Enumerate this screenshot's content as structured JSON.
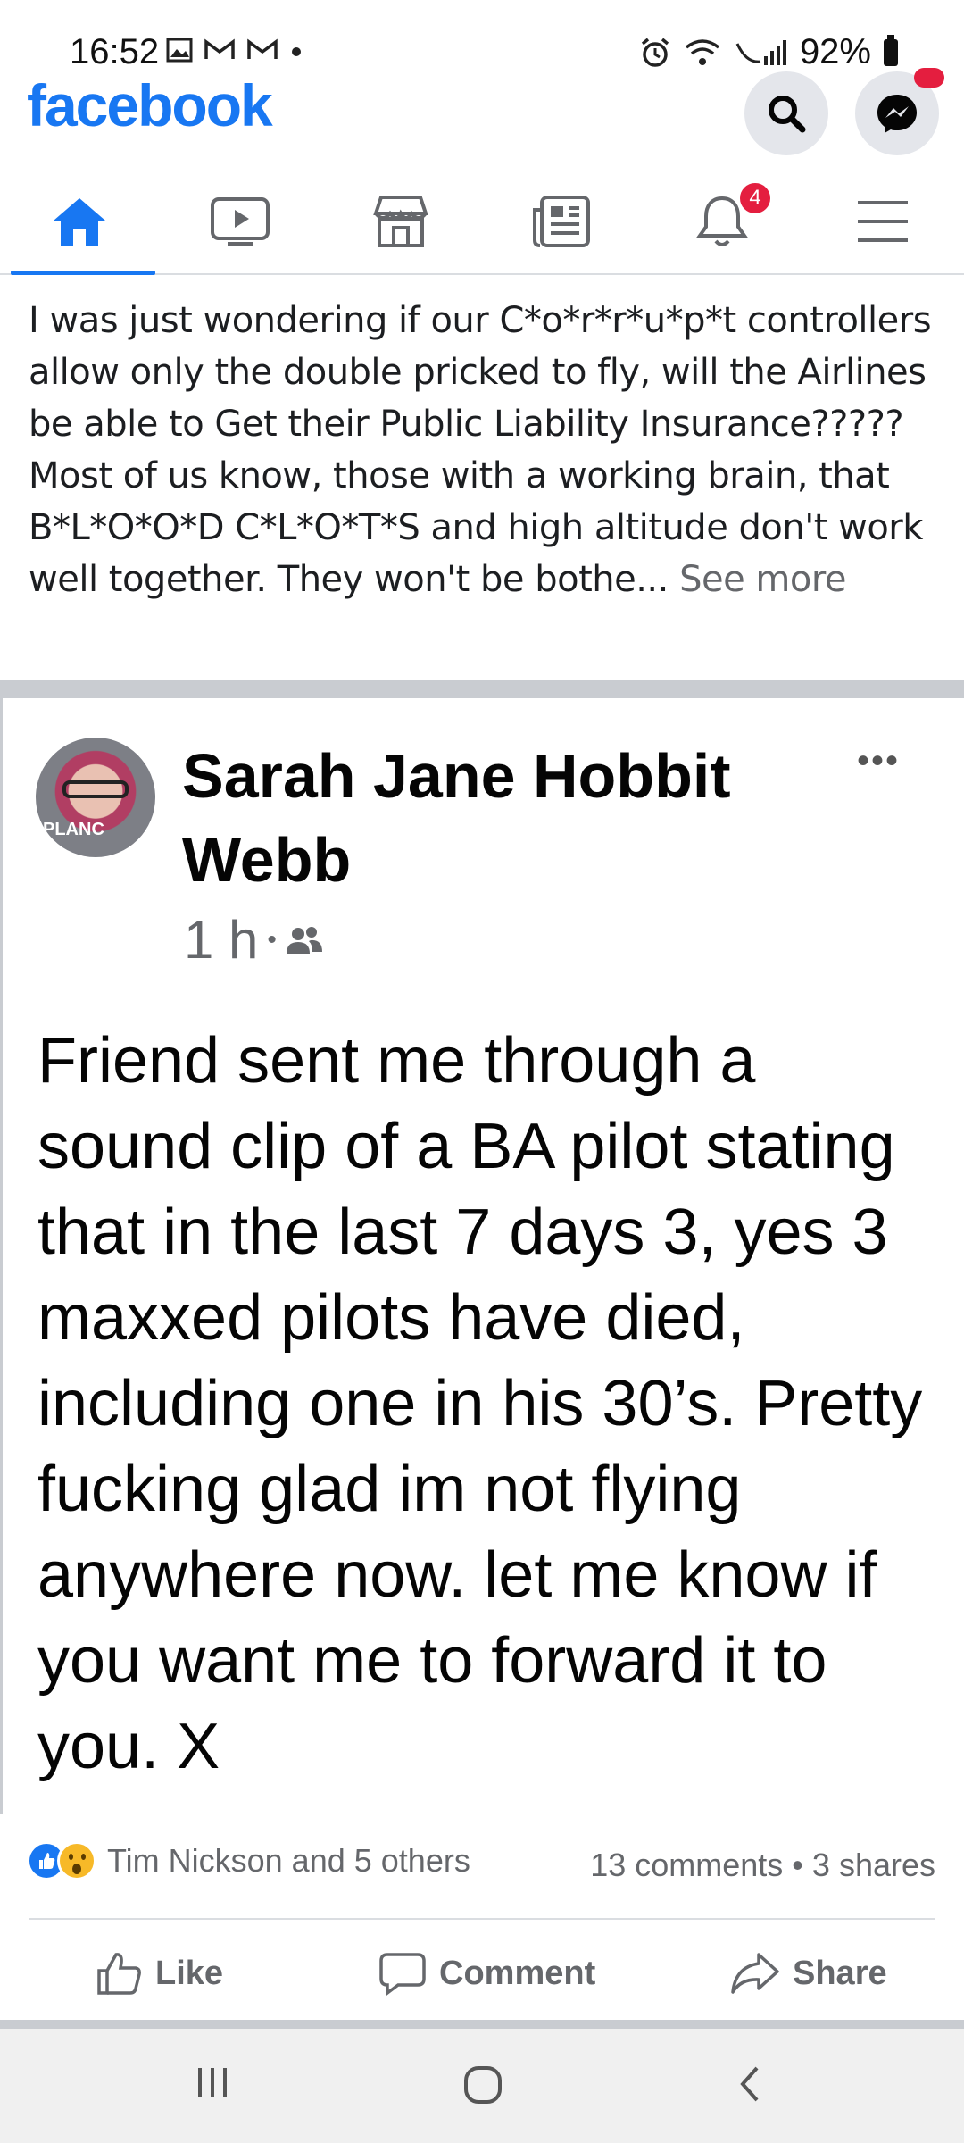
{
  "status_bar": {
    "time": "16:52",
    "battery": "92%"
  },
  "header": {
    "logo": "facebook"
  },
  "nav": {
    "tabs": [
      "home-icon",
      "watch-icon",
      "marketplace-icon",
      "news-icon",
      "bell-icon",
      "menu-icon"
    ],
    "notification_count": "4"
  },
  "shared_post": {
    "text": "I was just wondering if our C*o*r*r*u*p*t controllers allow only the double pricked to fly, will the Airlines be able to Get their Public Liability Insurance????? Most of us know, those with a working brain, that B*L*O*O*D  C*L*O*T*S and high altitude don't work well together. They won't be bothe...",
    "see_more": "See more"
  },
  "inner_post": {
    "author": "Sarah Jane Hobbit Webb",
    "avatar_text": "PLANC",
    "time": "1 h",
    "audience_icon": "friends-icon",
    "body": "Friend sent me through a sound clip of a BA pilot stating that in the last 7 days 3, yes 3 maxxed pilots have died, including one in his 30’s. Pretty fucking glad im not flying anywhere now. let me know if you want me to forward it to you. X"
  },
  "engagement": {
    "reactions": "Tim Nickson and 5 others",
    "counts": "13 comments • 3 shares"
  },
  "actions": {
    "like": "Like",
    "comment": "Comment",
    "share": "Share"
  },
  "colors": {
    "brand": "#1877f2",
    "badge": "#e41e3f",
    "muted": "#65676b"
  }
}
